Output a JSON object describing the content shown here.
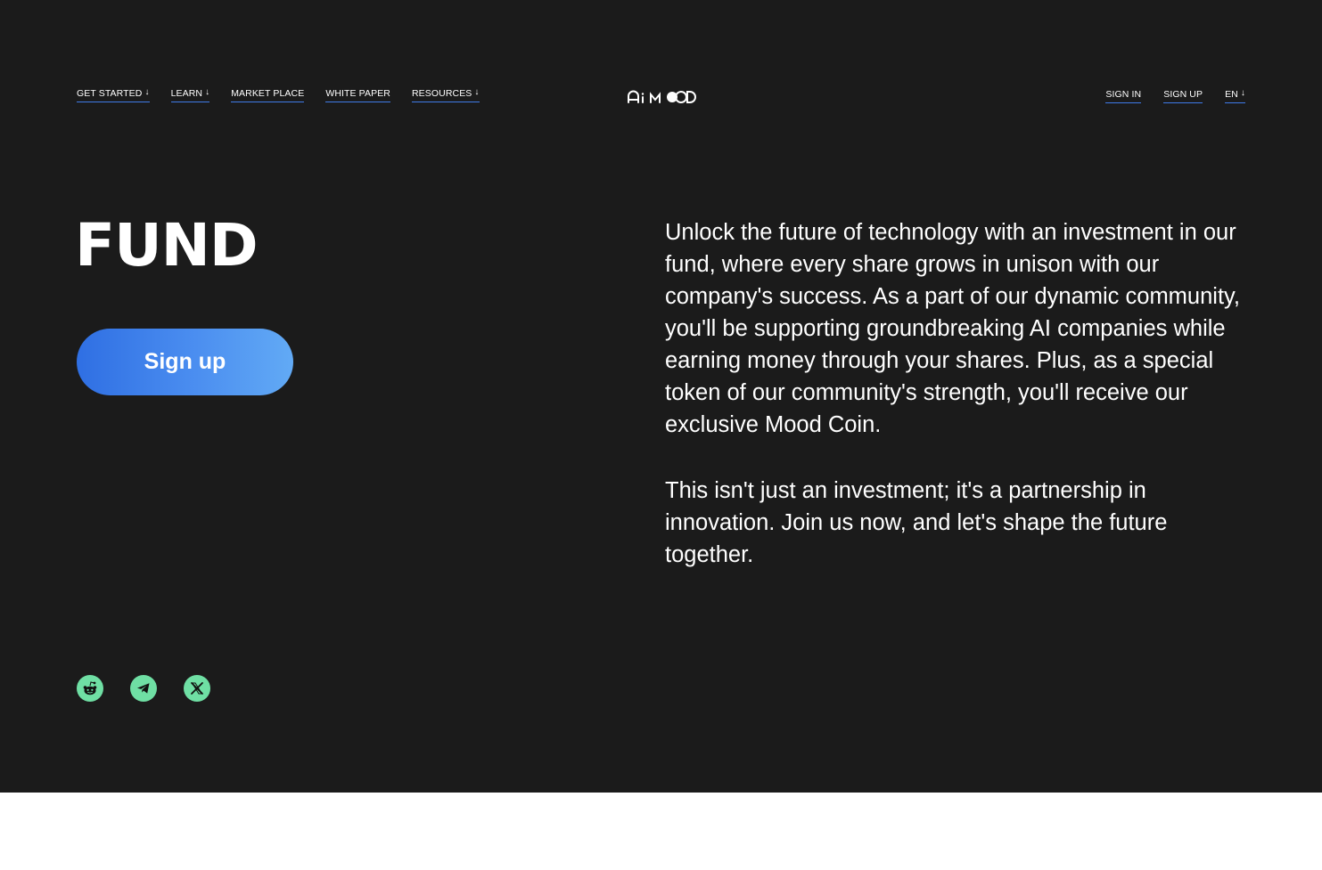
{
  "nav": {
    "left": [
      {
        "label": "GET STARTED",
        "arrow": "↓"
      },
      {
        "label": "LEARN",
        "arrow": "↓"
      },
      {
        "label": "MARKET PLACE"
      },
      {
        "label": "WHITE PAPER"
      },
      {
        "label": "RESOURCES",
        "arrow": "↓"
      }
    ],
    "logo_text": "Ai MOOD",
    "right": {
      "sign_in": "SIGN IN",
      "sign_up": "SIGN UP",
      "language": "EN",
      "language_arrow": "↓"
    }
  },
  "hero": {
    "title": "FUND",
    "cta_label": "Sign up",
    "paragraphs": [
      "Unlock the future of technology with an investment in our fund, where every share grows in unison with our company's success. As a part of our dynamic community, you'll be supporting groundbreaking AI companies while earning money through your shares. Plus, as a special token of our community's strength, you'll receive our exclusive Mood Coin.",
      "This isn't just an investment; it's a partnership in innovation. Join us now, and let's shape the future together."
    ]
  },
  "socials": [
    {
      "icon": "reddit-icon"
    },
    {
      "icon": "telegram-icon"
    },
    {
      "icon": "x-icon"
    }
  ],
  "colors": {
    "background": "#1b1b1b",
    "accent_underline": "#3f7be9",
    "button_gradient_start": "#2f6fe3",
    "button_gradient_end": "#62aaf5",
    "social_green": "#6fdfa4",
    "footer": "#ffffff"
  }
}
